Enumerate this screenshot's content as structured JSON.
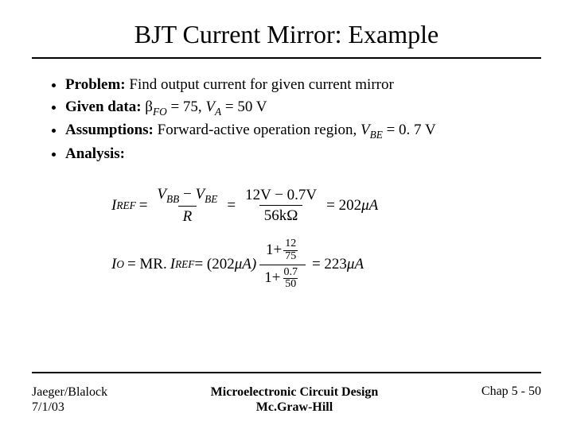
{
  "title": "BJT Current Mirror: Example",
  "bullets": {
    "problem": {
      "label": "Problem:",
      "text": " Find output current for given current mirror"
    },
    "given": {
      "label": "Given data:",
      "beta_sym": "β",
      "beta_sub": "FO",
      "beta_val": " = 75, ",
      "va_sym": "V",
      "va_sub": "A",
      "va_val": " = 50 V"
    },
    "assumptions": {
      "label": "Assumptions:",
      "text": " Forward-active operation region, ",
      "vbe_sym": "V",
      "vbe_sub": "BE",
      "vbe_val": " = 0. 7 V"
    },
    "analysis": {
      "label": "Analysis:"
    }
  },
  "eq1": {
    "lhs_I": "I",
    "lhs_sub": "REF",
    "eq": "=",
    "num1a": "V",
    "num1a_sub": "BB",
    "minus": "−",
    "num1b": "V",
    "num1b_sub": "BE",
    "den1": "R",
    "num2": "12V − 0.7V",
    "den2": "56kΩ",
    "result": "= 202",
    "unit": "μA"
  },
  "eq2": {
    "lhs_I": "I",
    "lhs_sub": "O",
    "eq": "= MR.",
    "iref": "I",
    "iref_sub": "REF",
    "paren_open": " = (202",
    "paren_unit": "μA)",
    "tf_top_lead": "1+",
    "tf_top_num": "12",
    "tf_top_den": "75",
    "tf_bot_lead": "1+",
    "tf_bot_num": "0.7",
    "tf_bot_den": "50",
    "result": "= 223",
    "unit": "μA"
  },
  "footer": {
    "left1": "Jaeger/Blalock",
    "left2": "7/1/03",
    "center1": "Microelectronic Circuit Design",
    "center2": "Mc.Graw-Hill",
    "right": "Chap 5 - 50"
  }
}
